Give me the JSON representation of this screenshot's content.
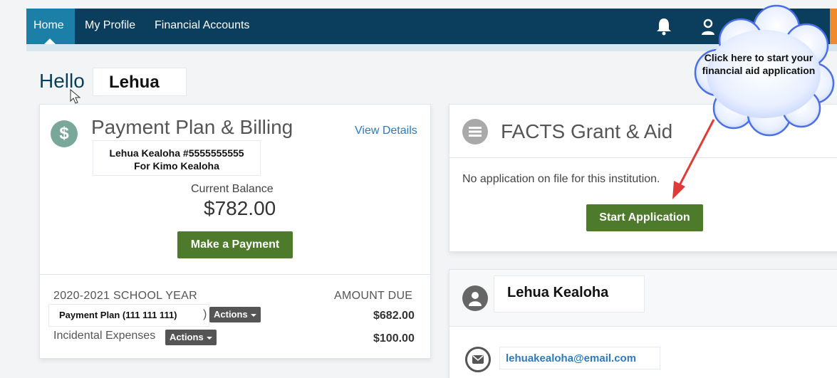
{
  "nav": {
    "items": [
      {
        "label": "Home",
        "active": true
      },
      {
        "label": "My Profile"
      },
      {
        "label": "Financial Accounts"
      }
    ],
    "icons": [
      "bell-icon",
      "user-icon"
    ]
  },
  "greeting": {
    "hello": "Hello",
    "name": "Lehua"
  },
  "billing": {
    "title": "Payment Plan & Billing",
    "view_details": "View Details",
    "account_line1": "Lehua Kealoha #5555555555",
    "account_line2": "For Kimo Kealoha",
    "current_balance_label": "Current Balance",
    "current_balance": "$782.00",
    "make_payment": "Make a Payment",
    "school_year": "2020-2021 SCHOOL YEAR",
    "amount_due_header": "AMOUNT DUE",
    "plan_label": "Payment Plan (111 111 111)",
    "plan_paren": ")",
    "actions_label": "Actions",
    "plan_amount": "$682.00",
    "incidental_label": "Incidental Expenses",
    "incidental_amount": "$100.00"
  },
  "facts": {
    "title": "FACTS Grant & Aid",
    "message": "No application on file for this institution.",
    "start_button": "Start Application"
  },
  "contact": {
    "name": "Lehua Kealoha",
    "email": "lehuakealoha@email.com"
  },
  "callout": {
    "text": "Click here to start your financial aid application"
  },
  "colors": {
    "nav_bg": "#0b3d5c",
    "nav_active": "#1b7fa8",
    "button_green": "#4e7a2c",
    "link_blue": "#2c7bbf",
    "arrow_red": "#e23a36",
    "cloud_fill": "#dbe7ff"
  }
}
